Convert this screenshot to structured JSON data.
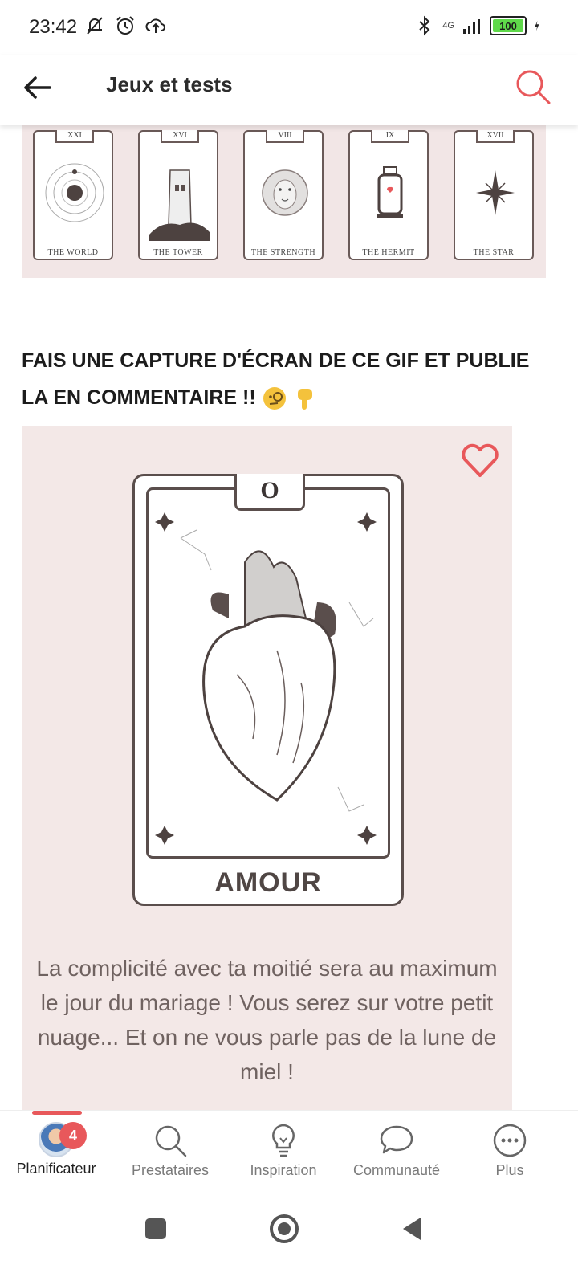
{
  "status_bar": {
    "time": "23:42",
    "left_icons": [
      "notifications-muted-icon",
      "alarm-icon",
      "cloud-sync-icon"
    ],
    "right_icons": [
      "bluetooth-icon",
      "signal-icon",
      "battery-icon",
      "charging-icon"
    ],
    "network": "4G",
    "battery": "100"
  },
  "app_bar": {
    "title": "Jeux et tests",
    "back_icon": "arrow-left-icon",
    "search_icon": "search-icon"
  },
  "tarot_strip": {
    "cards": [
      {
        "numeral": "XXI",
        "name": "THE WORLD"
      },
      {
        "numeral": "XVI",
        "name": "THE TOWER"
      },
      {
        "numeral": "VIII",
        "name": "THE STRENGTH"
      },
      {
        "numeral": "IX",
        "name": "THE HERMIT"
      },
      {
        "numeral": "XVII",
        "name": "THE STAR"
      }
    ]
  },
  "post": {
    "headline": "FAIS UNE CAPTURE D'ÉCRAN DE CE GIF ET PUBLIE LA EN COMMENTAIRE !!",
    "headline_emojis": [
      "monocle-face-emoji",
      "pointing-down-emoji"
    ]
  },
  "gif_card": {
    "numeral": "O",
    "label": "AMOUR",
    "description": "La complicité avec ta moitié sera au maximum le jour du mariage ! Vous serez sur votre petit nuage... Et on ne vous parle pas de la lune de miel !",
    "favorite_icon": "heart-outline-icon",
    "accent_color": "#e8585b"
  },
  "bottom_nav": {
    "items": [
      {
        "label": "Planificateur",
        "icon": "avatar",
        "badge": "4",
        "active": true
      },
      {
        "label": "Prestataires",
        "icon": "search-icon",
        "active": false
      },
      {
        "label": "Inspiration",
        "icon": "lightbulb-icon",
        "active": false
      },
      {
        "label": "Communauté",
        "icon": "chat-bubble-icon",
        "active": false
      },
      {
        "label": "Plus",
        "icon": "more-icon",
        "active": false
      }
    ]
  },
  "system_nav": [
    "recents-icon",
    "home-icon",
    "back-icon"
  ]
}
